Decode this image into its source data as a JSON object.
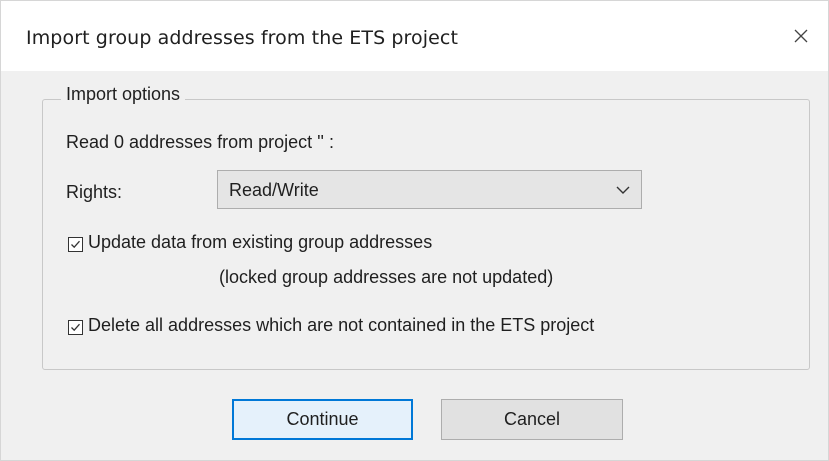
{
  "window": {
    "title": "Import group addresses from the ETS project"
  },
  "group": {
    "legend": "Import options"
  },
  "read_info": "Read 0 addresses from project '' :",
  "rights": {
    "label": "Rights:",
    "selected": "Read/Write"
  },
  "options": {
    "update_existing": {
      "label": "Update data from existing group addresses",
      "checked": true,
      "note": "(locked group addresses are not updated)"
    },
    "delete_missing": {
      "label": "Delete all addresses which are not contained in the ETS project",
      "checked": true
    }
  },
  "buttons": {
    "continue": "Continue",
    "cancel": "Cancel"
  },
  "colors": {
    "accent": "#0078d7",
    "dialog_bg": "#f0f0f0"
  }
}
